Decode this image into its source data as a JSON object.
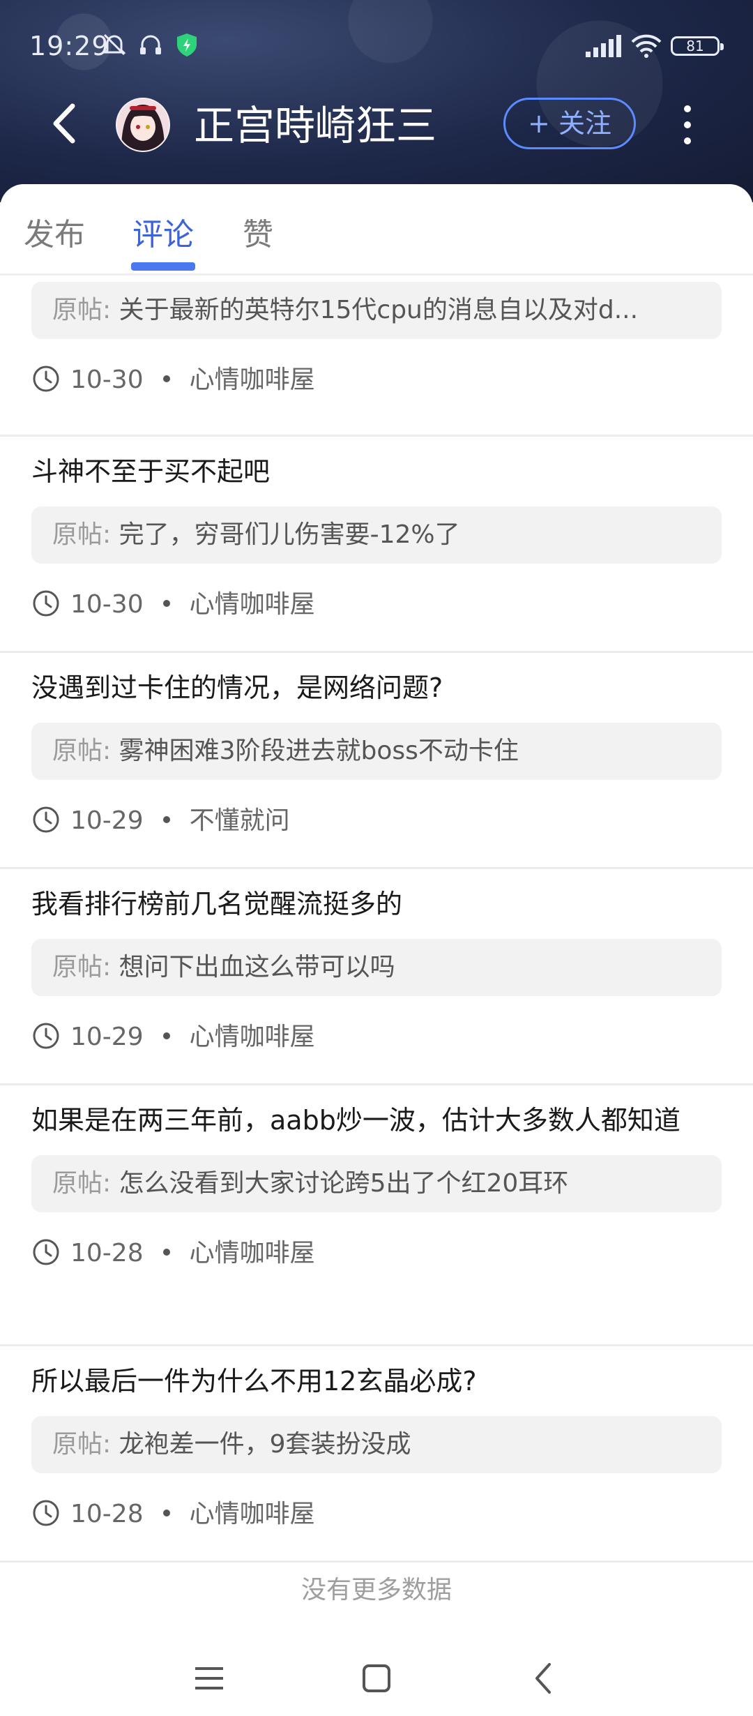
{
  "status_bar": {
    "time": "19:29",
    "battery": "81",
    "icons": [
      "bell-off-icon",
      "headset-icon",
      "shield-icon",
      "signal-icon",
      "wifi-icon",
      "battery-icon"
    ]
  },
  "header": {
    "title": "正宫時崎狂三",
    "follow_label": "+ 关注",
    "accent": "#5b8cff"
  },
  "tabs": [
    {
      "label": "发布",
      "active": false
    },
    {
      "label": "评论",
      "active": true
    },
    {
      "label": "赞",
      "active": false
    }
  ],
  "orig_label": "原帖:",
  "items": [
    {
      "comment": "",
      "orig": "关于最新的英特尔15代cpu的消息自以及对d...",
      "date": "10-30",
      "forum": "心情咖啡屋"
    },
    {
      "comment": "斗神不至于买不起吧",
      "orig": "完了，穷哥们儿伤害要-12%了",
      "date": "10-30",
      "forum": "心情咖啡屋"
    },
    {
      "comment": "没遇到过卡住的情况，是网络问题?",
      "orig": "雾神困难3阶段进去就boss不动卡住",
      "date": "10-29",
      "forum": "不懂就问"
    },
    {
      "comment": "我看排行榜前几名觉醒流挺多的",
      "orig": "想问下出血这么带可以吗",
      "date": "10-29",
      "forum": "心情咖啡屋"
    },
    {
      "comment": "如果是在两三年前，aabb炒一波，估计大多数人都知道",
      "orig": "怎么没看到大家讨论跨5出了个红20耳环",
      "date": "10-28",
      "forum": "心情咖啡屋"
    },
    {
      "comment": "所以最后一件为什么不用12玄晶必成?",
      "orig": "龙袍差一件，9套装扮没成",
      "date": "10-28",
      "forum": "心情咖啡屋"
    }
  ],
  "footer_text": "没有更多数据"
}
